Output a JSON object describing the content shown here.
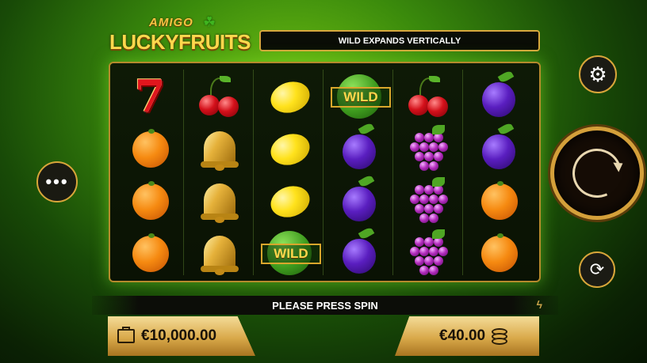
{
  "logo": {
    "top": "AMIGO",
    "main": "LUCKYFRUITS",
    "icon": "clover-icon"
  },
  "banner": {
    "text": "WILD EXPANDS VERTICALLY"
  },
  "reels": [
    [
      "seven",
      "orange",
      "orange",
      "orange"
    ],
    [
      "cherry",
      "bell",
      "bell",
      "bell"
    ],
    [
      "lemon",
      "lemon",
      "lemon",
      "wild"
    ],
    [
      "wild",
      "plum",
      "plum",
      "plum"
    ],
    [
      "cherry",
      "grapes",
      "grapes",
      "grapes"
    ],
    [
      "plum",
      "plum",
      "orange",
      "orange"
    ]
  ],
  "symbols": {
    "seven_text": "7",
    "wild_text": "WILD"
  },
  "controls": {
    "more_icon": "ellipsis-icon",
    "more_text": "•••",
    "settings_icon": "gear-icon",
    "settings_text": "⚙",
    "spin_icon": "spin-arrow-icon",
    "autoplay_icon": "autoplay-icon",
    "autoplay_text": "⟳"
  },
  "message": {
    "text": "PLEASE PRESS SPIN",
    "icon": "lightning-icon",
    "icon_text": "ϟ"
  },
  "balance": {
    "icon": "wallet-icon",
    "value": "€10,000.00"
  },
  "bet": {
    "value": "€40.00",
    "icon": "coins-icon"
  },
  "colors": {
    "gold": "#d8a63a",
    "green": "#3e9b1e",
    "dark": "#0c0d08"
  }
}
